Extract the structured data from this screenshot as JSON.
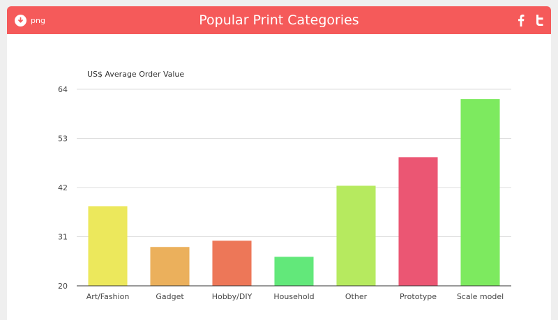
{
  "header": {
    "title": "Popular Print Categories",
    "download_label": "png",
    "download_icon": "download-icon",
    "share_icons": [
      "facebook-icon",
      "twitter-icon"
    ],
    "header_color": "#f55a5a"
  },
  "chart_data": {
    "type": "bar",
    "title": "Popular Print Categories",
    "xlabel": "",
    "ylabel": "US$ Average Order Value",
    "ylim": [
      20,
      64
    ],
    "yticks": [
      20,
      31,
      42,
      53,
      64
    ],
    "grid": true,
    "categories": [
      "Art/Fashion",
      "Gadget",
      "Hobby/DIY",
      "Household",
      "Other",
      "Prototype",
      "Scale model"
    ],
    "values": [
      37.8,
      28.7,
      30.1,
      26.5,
      42.4,
      48.8,
      61.8
    ],
    "colors": [
      "#ece85c",
      "#ebb05c",
      "#ed7758",
      "#62e87a",
      "#b6ea5f",
      "#eb5673",
      "#7dea5f"
    ]
  }
}
